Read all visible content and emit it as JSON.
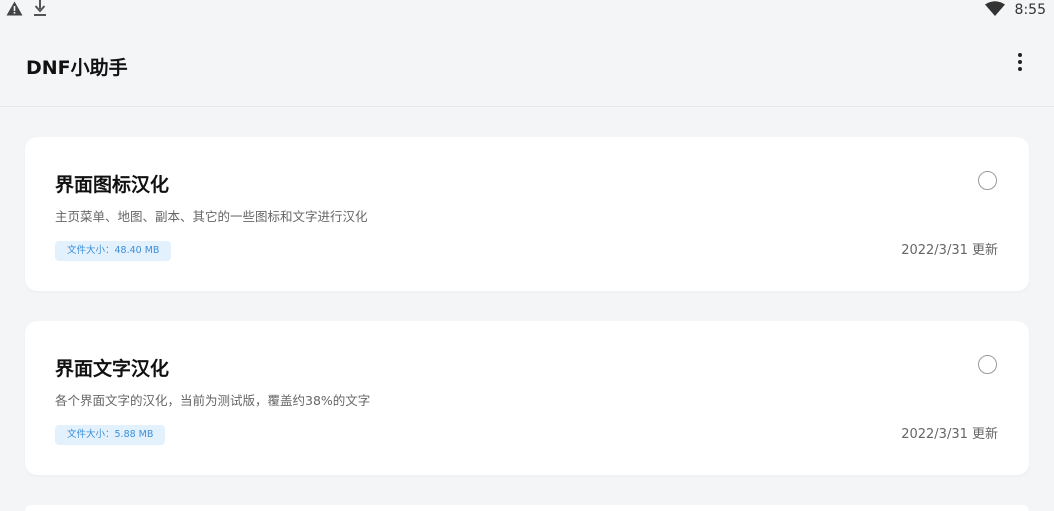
{
  "status_bar": {
    "time": "8:55",
    "icons": [
      "warning-icon",
      "download-icon",
      "wifi-icon"
    ]
  },
  "app_bar": {
    "title": "DNF小助手",
    "menu_icon": "more-vert-icon"
  },
  "cards": [
    {
      "title": "界面图标汉化",
      "description": "主页菜单、地图、副本、其它的一些图标和文字进行汉化",
      "size_label": "文件大小：48.40 MB",
      "date": "2022/3/31 更新",
      "selected": false
    },
    {
      "title": "界面文字汉化",
      "description": "各个界面文字的汉化，当前为测试版，覆盖约38%的文字",
      "size_label": "文件大小：5.88 MB",
      "date": "2022/3/31 更新",
      "selected": false
    }
  ],
  "colors": {
    "background": "#f4f5f7",
    "card": "#ffffff",
    "badge_bg": "#e3f1fd",
    "badge_text": "#3d8fd8"
  }
}
